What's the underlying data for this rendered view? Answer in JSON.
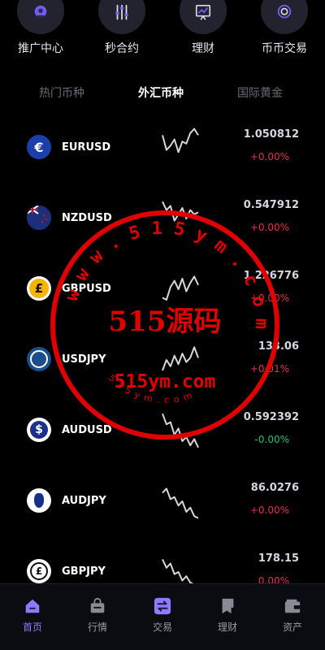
{
  "quick_actions": [
    {
      "label": "推广中心",
      "icon": "user-badge-icon"
    },
    {
      "label": "秒合约",
      "icon": "sliders-icon"
    },
    {
      "label": "理财",
      "icon": "chart-board-icon"
    },
    {
      "label": "币币交易",
      "icon": "coin-circle-icon"
    }
  ],
  "tabs": [
    {
      "label": "热门币种",
      "active": false
    },
    {
      "label": "外汇币种",
      "active": true
    },
    {
      "label": "国际黄金",
      "active": false
    }
  ],
  "markets": [
    {
      "symbol": "EURUSD",
      "price": "1.050812",
      "change": "+0.00%",
      "dir": "up",
      "icon": "euro-icon",
      "spark": [
        0.2,
        0.55,
        0.45,
        0.3,
        0.6,
        0.35,
        0.4,
        0.15,
        0.05,
        0.2
      ]
    },
    {
      "symbol": "NZDUSD",
      "price": "0.547912",
      "change": "+0.00%",
      "dir": "up",
      "icon": "new-zealand-flag-icon",
      "spark": [
        0.1,
        0.3,
        0.2,
        0.55,
        0.4,
        0.25,
        0.5,
        0.3,
        0.4,
        0.35
      ]
    },
    {
      "symbol": "GBPUSD",
      "price": "1.226776",
      "change": "+0.00%",
      "dir": "up",
      "icon": "pound-icon",
      "spark": [
        0.7,
        0.75,
        0.45,
        0.3,
        0.5,
        0.25,
        0.55,
        0.35,
        0.2,
        0.4
      ]
    },
    {
      "symbol": "USDJPY",
      "price": "133.06",
      "change": "+0.01%",
      "dir": "up",
      "icon": "globe-seal-icon",
      "spark": [
        0.75,
        0.5,
        0.65,
        0.4,
        0.6,
        0.35,
        0.55,
        0.45,
        0.2,
        0.45
      ]
    },
    {
      "symbol": "AUDUSD",
      "price": "0.592392",
      "change": "-0.00%",
      "dir": "down",
      "icon": "dollar-icon",
      "spark": [
        0.1,
        0.35,
        0.3,
        0.6,
        0.45,
        0.75,
        0.65,
        0.85,
        0.7,
        0.9
      ]
    },
    {
      "symbol": "AUDJPY",
      "price": "86.0276",
      "change": "+0.00%",
      "dir": "up",
      "icon": "australia-map-icon",
      "spark": [
        0.3,
        0.2,
        0.45,
        0.4,
        0.6,
        0.5,
        0.75,
        0.65,
        0.85,
        0.9
      ]
    },
    {
      "symbol": "GBPJPY",
      "price": "178.15",
      "change": "0.00%",
      "dir": "up",
      "icon": "exchange-icon",
      "spark": [
        0.2,
        0.4,
        0.3,
        0.55,
        0.5,
        0.7,
        0.6,
        0.75,
        0.8,
        0.85
      ]
    }
  ],
  "watermark": {
    "center_text": "515源码",
    "sub_text": "515ym.com",
    "ring_text": "www.515ym.com",
    "small_text": "515ym.com",
    "color": "#e00000"
  },
  "nav": [
    {
      "label": "首页",
      "icon": "home-icon",
      "active": true
    },
    {
      "label": "行情",
      "icon": "bag-icon",
      "active": false
    },
    {
      "label": "交易",
      "icon": "swap-icon",
      "active": false
    },
    {
      "label": "理财",
      "icon": "bookmark-icon",
      "active": false
    },
    {
      "label": "资产",
      "icon": "wallet-icon",
      "active": false
    }
  ],
  "colors": {
    "up": "#e0344a",
    "down": "#2fbf71",
    "accent": "#8b7bff",
    "background": "#000000"
  }
}
